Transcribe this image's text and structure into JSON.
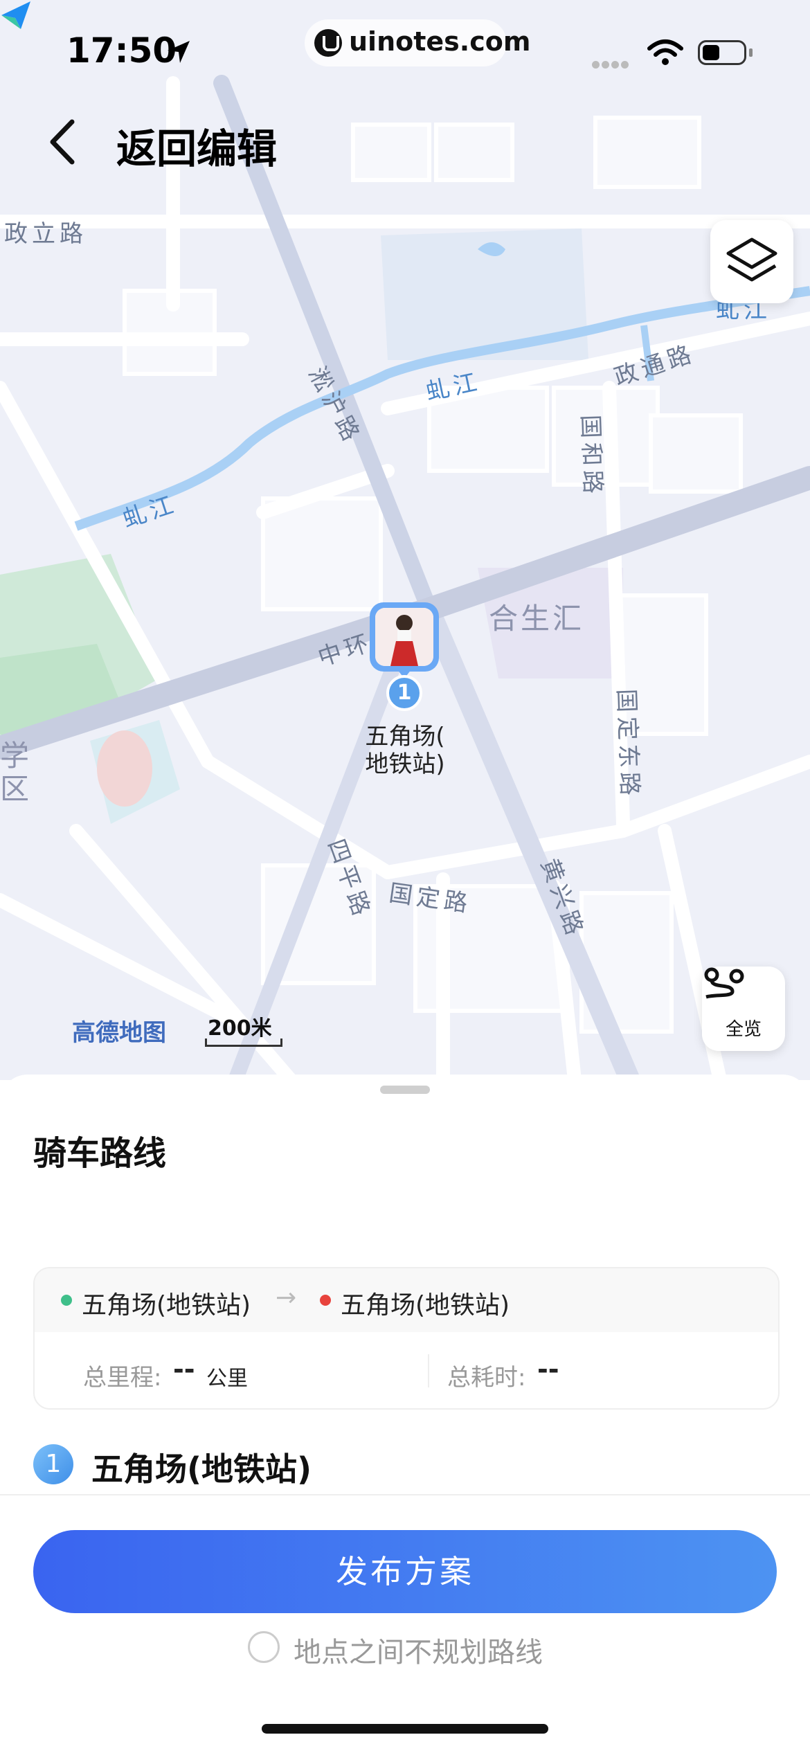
{
  "status_bar": {
    "time": "17:50",
    "url": "uinotes.com"
  },
  "header": {
    "back_label": "返回编辑"
  },
  "map": {
    "streets": [
      "政立路",
      "淞沪路",
      "虬江",
      "虬江",
      "政通路",
      "国和路",
      "中环路",
      "合生汇",
      "国定东路",
      "四平路",
      "国定路",
      "黄兴路",
      "学区",
      "虬江"
    ],
    "marker": {
      "number": "1",
      "label_line1": "五角场(",
      "label_line2": "地铁站)"
    },
    "provider": "高德地图",
    "scale": "200米",
    "overview_label": "全览",
    "icons": [
      "layers-icon",
      "route-overview-icon",
      "location-arrow-icon",
      "back-chevron-icon"
    ]
  },
  "sheet": {
    "title": "骑车路线",
    "route": {
      "from": "五角场(地铁站)",
      "arrow": "→",
      "to": "五角场(地铁站)",
      "distance_label": "总里程:",
      "distance_value": "--",
      "distance_unit": "公里",
      "duration_label": "总耗时:",
      "duration_value": "--"
    },
    "stop": {
      "number": "1",
      "name": "五角场(地铁站)"
    },
    "publish_label": "发布方案",
    "no_route_label": "地点之间不规划路线"
  },
  "colors": {
    "accent": "#3a64f0",
    "river": "#a9d0f5",
    "start_dot": "#3fbf8a",
    "end_dot": "#e8433d"
  }
}
